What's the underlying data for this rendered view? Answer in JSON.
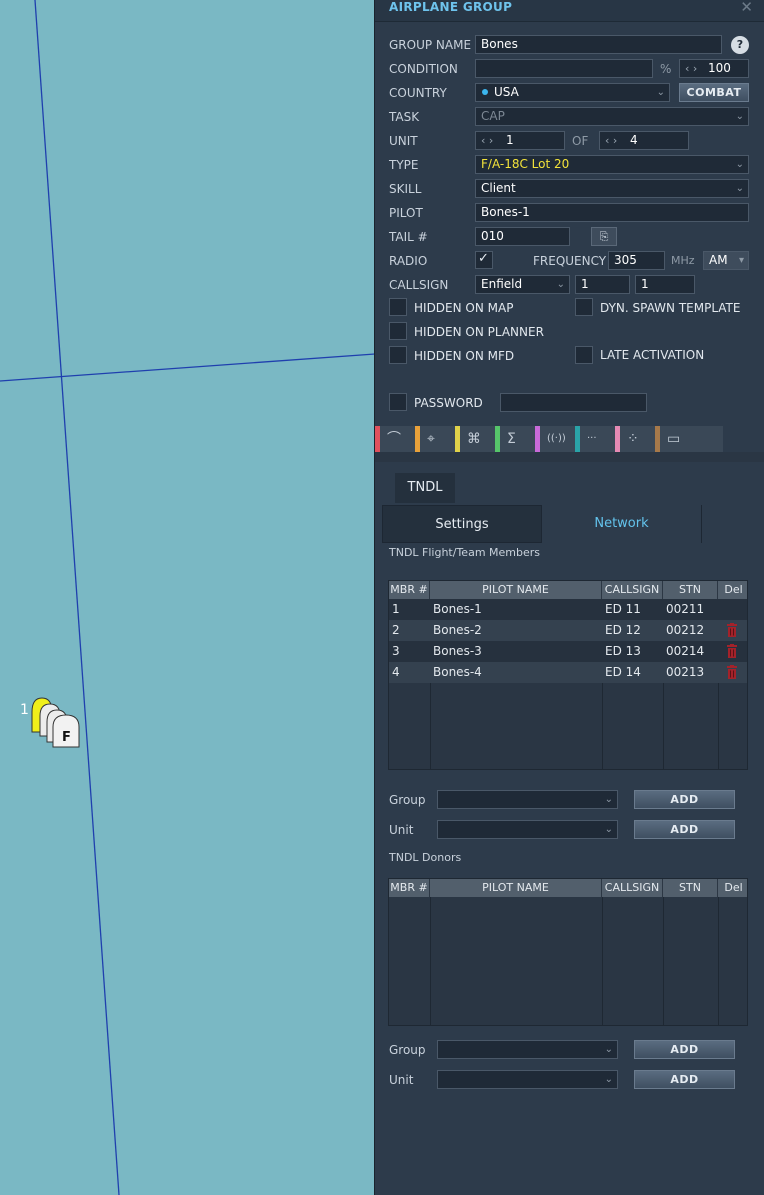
{
  "map": {
    "unit_number": "1",
    "unit_letter": "F"
  },
  "panel": {
    "title": "AIRPLANE GROUP",
    "close_icon": "close-icon",
    "help_label": "?",
    "group_name": {
      "label": "GROUP NAME",
      "value": "Bones"
    },
    "condition": {
      "label": "CONDITION",
      "value": "",
      "unit": "%",
      "spin_value": "100"
    },
    "country": {
      "label": "COUNTRY",
      "value": "USA",
      "button": "COMBAT"
    },
    "task": {
      "label": "TASK",
      "value": "CAP"
    },
    "unit": {
      "label": "UNIT",
      "value": "1",
      "of_label": "OF",
      "total": "4"
    },
    "type": {
      "label": "TYPE",
      "value": "F/A-18C Lot 20"
    },
    "skill": {
      "label": "SKILL",
      "value": "Client"
    },
    "pilot": {
      "label": "PILOT",
      "value": "Bones-1"
    },
    "tail": {
      "label": "TAIL #",
      "value": "010"
    },
    "radio": {
      "label": "RADIO",
      "checked": true,
      "freq_label": "FREQUENCY",
      "freq_value": "305",
      "freq_unit": "MHz",
      "modulation": "AM"
    },
    "callsign": {
      "label": "CALLSIGN",
      "name": "Enfield",
      "num1": "1",
      "num2": "1"
    },
    "checkboxes": {
      "hidden_on_map": "HIDDEN ON MAP",
      "dyn_spawn": "DYN. SPAWN TEMPLATE",
      "hidden_on_planner": "HIDDEN ON PLANNER",
      "hidden_on_mfd": "HIDDEN ON MFD",
      "late_activation": "LATE ACTIVATION",
      "password": "PASSWORD"
    },
    "toolbar": [
      {
        "icon": "route-icon",
        "glyph": "⌒",
        "color": "#e0505c"
      },
      {
        "icon": "target-icon",
        "glyph": "⌖",
        "color": "#e8a13a"
      },
      {
        "icon": "drone-icon",
        "glyph": "⌘",
        "color": "#e0d24a"
      },
      {
        "icon": "sigma-icon",
        "glyph": "Σ",
        "color": "#56c56a"
      },
      {
        "icon": "radio-icon",
        "glyph": "((·))",
        "color": "#c86ad8"
      },
      {
        "icon": "dots-icon",
        "glyph": "···",
        "color": "#2aa3a8"
      },
      {
        "icon": "network-icon",
        "glyph": "⁘",
        "color": "#e58ab4"
      },
      {
        "icon": "payload-icon",
        "glyph": "▭",
        "color": "#a6794a"
      }
    ],
    "tndl_tab": "TNDL",
    "subtabs": {
      "settings": "Settings",
      "network": "Network"
    },
    "members_title": "TNDL Flight/Team Members",
    "table_headers": {
      "mbr": "MBR #",
      "pilot": "PILOT NAME",
      "callsign": "CALLSIGN",
      "stn": "STN",
      "del": "Del"
    },
    "members": [
      {
        "mbr": "1",
        "pilot": "Bones-1",
        "callsign": "ED 11",
        "stn": "00211"
      },
      {
        "mbr": "2",
        "pilot": "Bones-2",
        "callsign": "ED 12",
        "stn": "00212"
      },
      {
        "mbr": "3",
        "pilot": "Bones-3",
        "callsign": "ED 13",
        "stn": "00214"
      },
      {
        "mbr": "4",
        "pilot": "Bones-4",
        "callsign": "ED 14",
        "stn": "00213"
      }
    ],
    "group_label": "Group",
    "unit_label": "Unit",
    "add_label": "ADD",
    "donors_title": "TNDL Donors",
    "colors": {
      "accent": "#6ec3ec",
      "panel_bg": "#2d3b4b",
      "map_bg": "#7ab8c4",
      "delete": "#a3222a"
    }
  }
}
